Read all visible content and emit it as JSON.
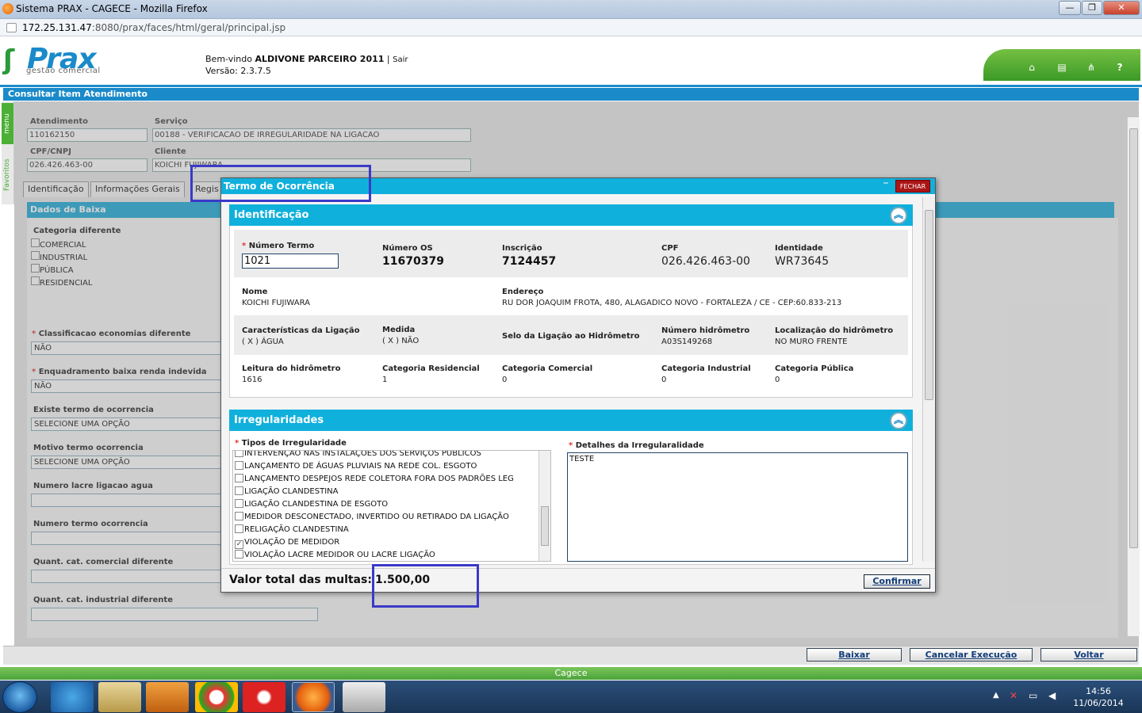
{
  "window": {
    "title": "Sistema PRAX - CAGECE - Mozilla Firefox",
    "minimize": "—",
    "restore": "❐",
    "close": "✕"
  },
  "url": {
    "host": "172.25.131.47",
    "path": ":8080/prax/faces/html/geral/principal.jsp"
  },
  "app": {
    "logo": "Prax",
    "logo_sub": "gestão comercial",
    "welcome_prefix": "Bem-vindo",
    "user": "ALDIVONE PARCEIRO 2011",
    "logout": "Sair",
    "version": "Versão: 2.3.7.5",
    "toolbar_icons": [
      "home-icon",
      "print-icon",
      "sitemap-icon",
      "help-icon"
    ],
    "help_glyph": "?"
  },
  "side": {
    "menu": "menu",
    "favorites": "Favoritos"
  },
  "page": {
    "title": "Consultar Item Atendimento",
    "fields": {
      "atendimento_label": "Atendimento",
      "atendimento": "110162150",
      "servico_label": "Serviço",
      "servico": "00188 - VERIFICACAO DE IRREGULARIDADE NA LIGACAO",
      "cpf_label": "CPF/CNPJ",
      "cpf": "026.426.463-00",
      "cliente_label": "Cliente",
      "cliente": "KOICHI FUJIWARA"
    },
    "tabs": [
      "Identificação",
      "Informações Gerais",
      "Regis"
    ],
    "dados_title": "Dados de Baixa",
    "categoria_label": "Categoria diferente",
    "categorias": [
      "COMERCIAL",
      "INDUSTRIAL",
      "PÚBLICA",
      "RESIDENCIAL"
    ],
    "form": [
      {
        "label": "Classificacao economias diferente",
        "required": true,
        "value": "NÃO"
      },
      {
        "label": "Enquadramento baixa renda indevida",
        "required": true,
        "value": "NÃO"
      },
      {
        "label": "Existe termo de ocorrencia",
        "required": false,
        "value": "SELECIONE UMA OPÇÃO"
      },
      {
        "label": "Motivo termo ocorrencia",
        "required": false,
        "value": "SELECIONE UMA OPÇÃO"
      },
      {
        "label": "Numero lacre ligacao agua",
        "required": false,
        "value": ""
      },
      {
        "label": "Numero termo ocorrencia",
        "required": false,
        "value": ""
      },
      {
        "label": "Quant. cat. comercial diferente",
        "required": false,
        "value": ""
      },
      {
        "label": "Quant. cat. industrial diferente",
        "required": false,
        "value": ""
      }
    ],
    "buttons": {
      "baixar": "Baixar",
      "cancelar": "Cancelar Execução",
      "voltar": "Voltar"
    },
    "footer_brand": "Cagece"
  },
  "modal": {
    "title": "Termo de Ocorrência",
    "close": "FECHAR",
    "identificacao": {
      "header": "Identificação",
      "numero_termo_label": "Número Termo",
      "numero_termo": "1021",
      "numero_os_label": "Número OS",
      "numero_os": "11670379",
      "inscricao_label": "Inscrição",
      "inscricao": "7124457",
      "cpf_label": "CPF",
      "cpf": "026.426.463-00",
      "identidade_label": "Identidade",
      "identidade": "WR73645",
      "nome_label": "Nome",
      "nome": "KOICHI FUJIWARA",
      "endereco_label": "Endereço",
      "endereco": "RU DOR JOAQUIM FROTA, 480, ALAGADICO NOVO - FORTALEZA / CE - CEP:60.833-213",
      "caracteristicas_label": "Características da Ligação",
      "caracteristicas": "( X ) ÁGUA",
      "medida_label": "Medida",
      "medida": "( X ) NÃO",
      "selo_label": "Selo da Ligação ao Hidrômetro",
      "num_hidrometro_label": "Número hidrômetro",
      "num_hidrometro": "A03S149268",
      "localizacao_label": "Localização do hidrômetro",
      "localizacao": "NO MURO FRENTE",
      "leitura_label": "Leitura do hidrômetro",
      "leitura": "1616",
      "cat_res_label": "Categoria Residencial",
      "cat_res": "1",
      "cat_com_label": "Categoria Comercial",
      "cat_com": "0",
      "cat_ind_label": "Categoria Industrial",
      "cat_ind": "0",
      "cat_pub_label": "Categoria Pública",
      "cat_pub": "0"
    },
    "irregularidades": {
      "header": "Irregularidades",
      "tipos_label": "Tipos de Irregularidade",
      "detalhes_label": "Detalhes da Irregularalidade",
      "detalhes": "TESTE",
      "items": [
        {
          "label": "INTERVENÇAO NAS INSTALAÇOES DOS SERVIÇOS PUBLICOS",
          "checked": false
        },
        {
          "label": "LANÇAMENTO DE ÁGUAS PLUVIAIS NA REDE COL. ESGOTO",
          "checked": false
        },
        {
          "label": "LANÇAMENTO DESPEJOS REDE COLETORA FORA DOS PADRÕES LEG",
          "checked": false
        },
        {
          "label": "LIGAÇÃO CLANDESTINA",
          "checked": false
        },
        {
          "label": "LIGAÇÃO CLANDESTINA DE ESGOTO",
          "checked": false
        },
        {
          "label": "MEDIDOR DESCONECTADO, INVERTIDO OU RETIRADO DA LIGAÇÃO",
          "checked": false
        },
        {
          "label": "RELIGAÇÃO CLANDESTINA",
          "checked": false
        },
        {
          "label": "VIOLAÇÃO DE MEDIDOR",
          "checked": true
        },
        {
          "label": "VIOLAÇÃO LACRE MEDIDOR OU LACRE LIGAÇÃO",
          "checked": false
        }
      ]
    },
    "total_label": "Valor total das multas:",
    "total_value": "1.500,00",
    "confirm": "Confirmar"
  },
  "taskbar": {
    "time": "14:56",
    "date": "11/06/2014"
  }
}
